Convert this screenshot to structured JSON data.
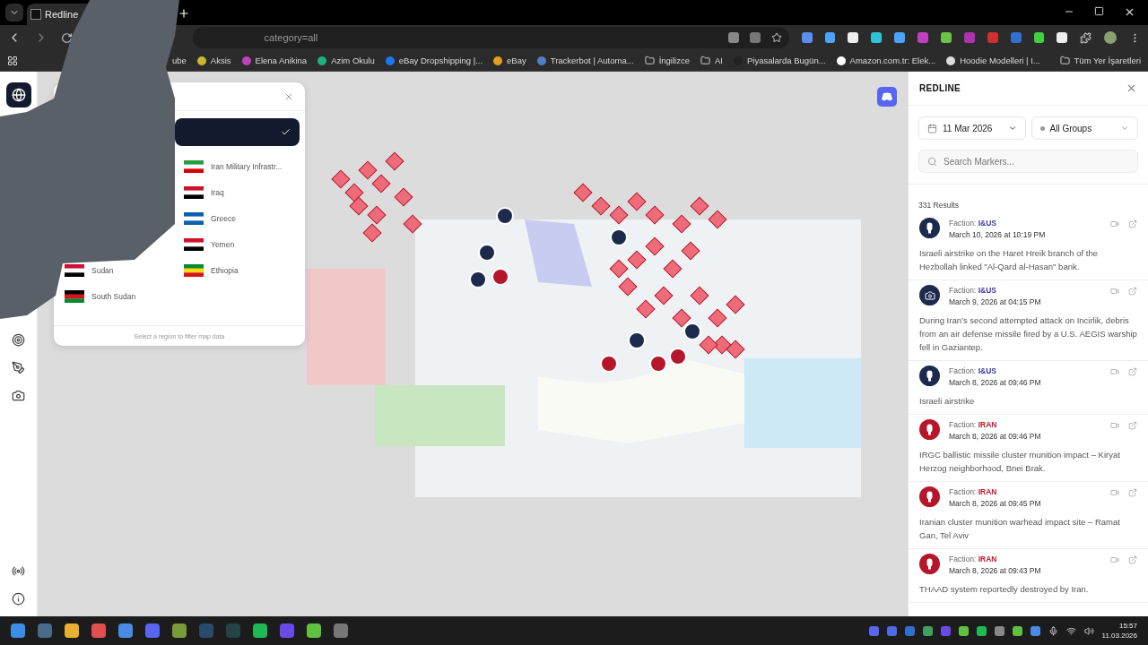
{
  "browser": {
    "tab_title": "Redline",
    "url": "category=all",
    "bookmarks": [
      {
        "label": "ube",
        "kind": "plain"
      },
      {
        "label": "Aksis",
        "kind": "site",
        "color": "#c8b830"
      },
      {
        "label": "Elena Anikina",
        "kind": "site",
        "color": "#c040c0"
      },
      {
        "label": "Azim Okulu",
        "kind": "site",
        "color": "#20b080"
      },
      {
        "label": "eBay Dropshipping |...",
        "kind": "site",
        "color": "#1877f2"
      },
      {
        "label": "eBay",
        "kind": "site",
        "color": "#e0a020"
      },
      {
        "label": "Trackerbot | Automa...",
        "kind": "site",
        "color": "#5080c0"
      },
      {
        "label": "İngilizce",
        "kind": "folder"
      },
      {
        "label": "AI",
        "kind": "folder"
      },
      {
        "label": "Piyasalarda Bugün...",
        "kind": "site",
        "color": "#222222"
      },
      {
        "label": "Amazon.com.tr: Elek...",
        "kind": "site",
        "color": "#ffffff"
      },
      {
        "label": "Hoodie Modelleri | I...",
        "kind": "site",
        "color": "#dddddd"
      }
    ],
    "all_bookmarks": "Tüm Yer İşaretleri"
  },
  "region_panel": {
    "top_option": {
      "selected": true
    },
    "left_column": [
      "Sudan",
      "South Sudan"
    ],
    "right_column": [
      "Iran Military Infrastr...",
      "Iraq",
      "Greece",
      "Yemen",
      "Ethiopia"
    ],
    "hint": "Select a region to filter map data"
  },
  "sidebar": {
    "title": "REDLINE",
    "date": "11 Mar 2026",
    "group": "All Groups",
    "search": {
      "placeholder": "Search Markers..."
    },
    "results": "331 Results",
    "markers": [
      {
        "kind": "ius-missile",
        "faction_label": "Faction:",
        "faction": "I&US",
        "time": "March 10, 2026 at 10:19 PM",
        "text": "Israeli airstrike on the Haret Hreik branch of the Hezbollah linked \"Al-Qard al-Hasan\" bank."
      },
      {
        "kind": "ius-camera",
        "faction_label": "Faction:",
        "faction": "I&US",
        "time": "March 9, 2026 at 04:15 PM",
        "text": "During Iran’s second attempted attack on Incirlik, debris from an air defense missile fired by a U.S. AEGIS warship fell in Gaziantep."
      },
      {
        "kind": "ius-missile",
        "faction_label": "Faction:",
        "faction": "I&US",
        "time": "March 8, 2026 at 09:46 PM",
        "text": "Israeli airstrike"
      },
      {
        "kind": "iran-missile",
        "faction_label": "Faction:",
        "faction": "IRAN",
        "time": "March 8, 2026 at 09:46 PM",
        "text": "IRGC ballistic missile cluster munition impact – Kiryat Herzog neighborhood, Bnei Brak."
      },
      {
        "kind": "iran-missile",
        "faction_label": "Faction:",
        "faction": "IRAN",
        "time": "March 8, 2026 at 09:45 PM",
        "text": "Iranian cluster munition warhead impact site – Ramat Gan, Tel Aviv"
      },
      {
        "kind": "iran-missile",
        "faction_label": "Faction:",
        "faction": "IRAN",
        "time": "March 8, 2026 at 09:43 PM",
        "text": "THAAD system reportedly destroyed by Iran."
      }
    ]
  },
  "taskbar": {
    "time": "15:57",
    "date": "11.03.2026"
  }
}
